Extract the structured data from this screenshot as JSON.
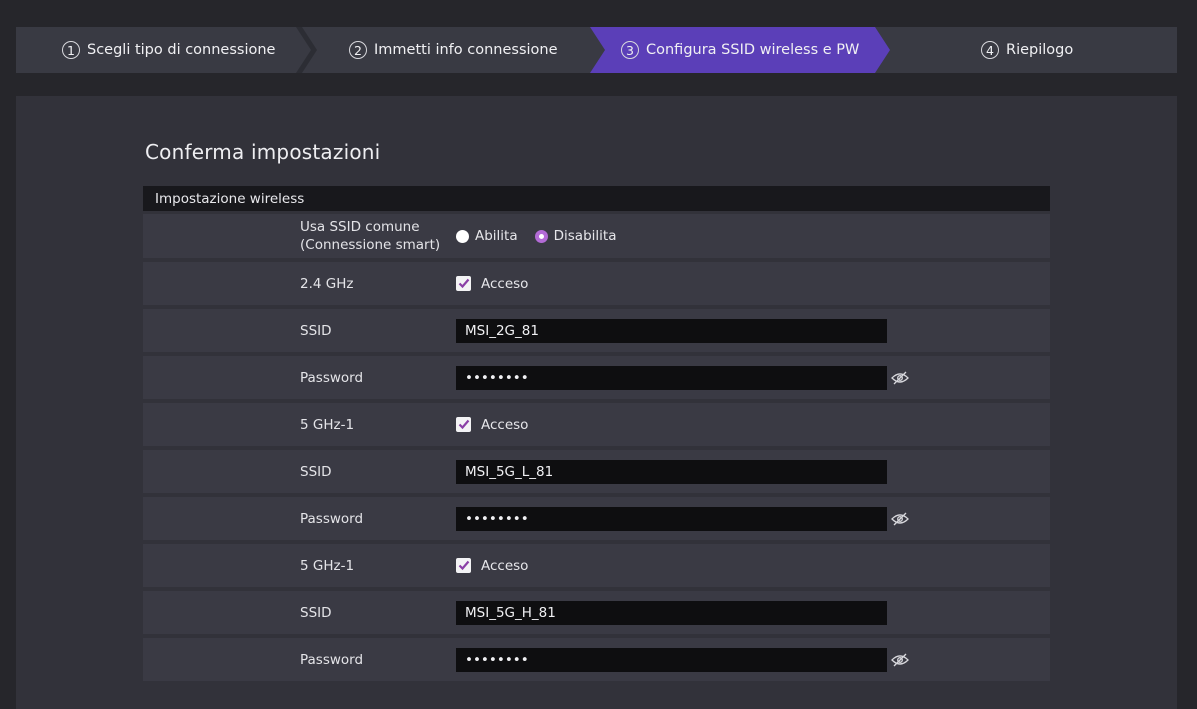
{
  "wizard": {
    "steps": [
      {
        "num": "1",
        "label": "Scegli tipo di connessione"
      },
      {
        "num": "2",
        "label": "Immetti info connessione"
      },
      {
        "num": "3",
        "label": "Configura SSID wireless e PW"
      },
      {
        "num": "4",
        "label": "Riepilogo"
      }
    ],
    "active_step": 3
  },
  "main": {
    "title": "Conferma impostazioni",
    "section": "Impostazione wireless",
    "common_ssid": {
      "label_line1": "Usa SSID comune",
      "label_line2": "(Connessione smart)",
      "enable_label": "Abilita",
      "disable_label": "Disabilita",
      "selected": "Disabilita"
    },
    "bands": [
      {
        "band_label": "2.4 GHz",
        "status_label": "Acceso",
        "checked": true,
        "ssid_label": "SSID",
        "ssid_value": "MSI_2G_81",
        "password_label": "Password",
        "password_value": "••••••••"
      },
      {
        "band_label": "5 GHz-1",
        "status_label": "Acceso",
        "checked": true,
        "ssid_label": "SSID",
        "ssid_value": "MSI_5G_L_81",
        "password_label": "Password",
        "password_value": "••••••••"
      },
      {
        "band_label": "5 GHz-1",
        "status_label": "Acceso",
        "checked": true,
        "ssid_label": "SSID",
        "ssid_value": "MSI_5G_H_81",
        "password_label": "Password",
        "password_value": "••••••••"
      }
    ]
  },
  "colors": {
    "accent": "#5b3fb8",
    "radio_on": "#b36bd6",
    "check": "#8a3fa6",
    "background": "#26262b",
    "panel": "#32323a",
    "row": "#3a3a44"
  },
  "icons": {
    "password_toggle": "eye-slash-icon",
    "checkbox": "checkmark-icon"
  }
}
